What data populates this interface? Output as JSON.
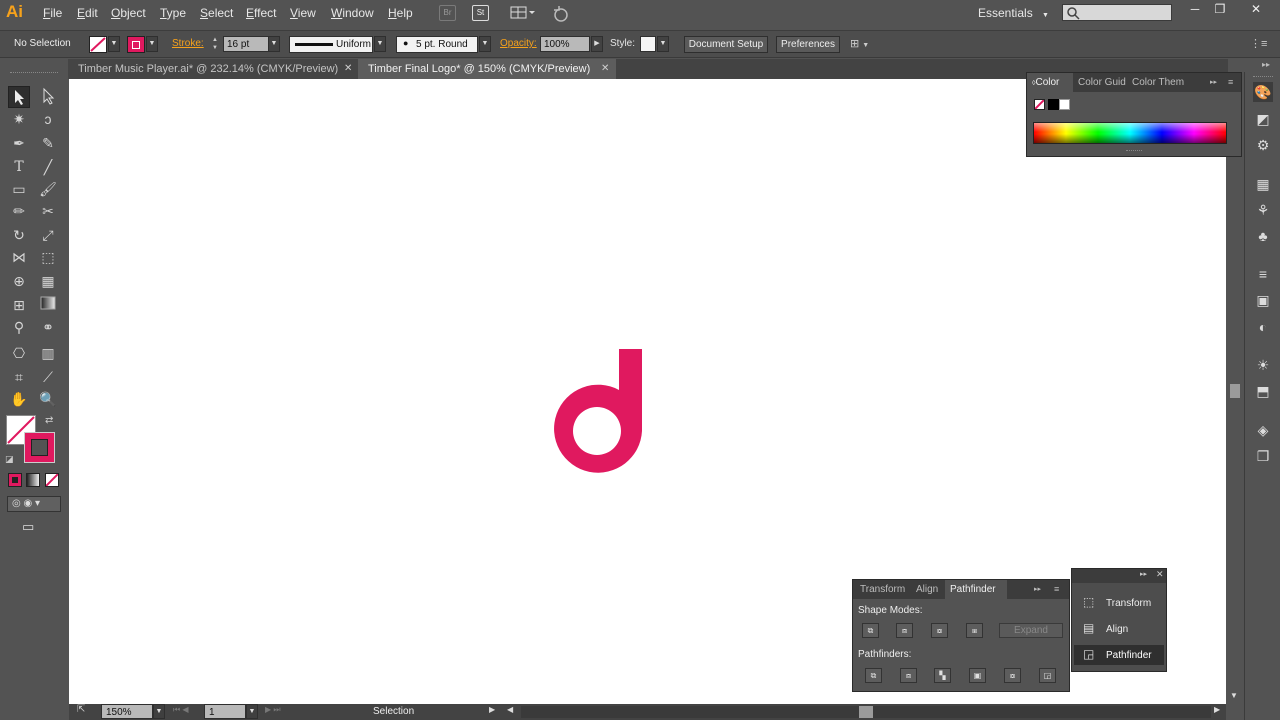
{
  "app": {
    "logo": "Ai"
  },
  "menu": [
    "File",
    "Edit",
    "Object",
    "Type",
    "Select",
    "Effect",
    "View",
    "Window",
    "Help"
  ],
  "menu_buttons": {
    "bridge": "Br",
    "stock": "St"
  },
  "workspace": {
    "label": "Essentials"
  },
  "search": {
    "placeholder": ""
  },
  "window_controls": {
    "minimize": "─",
    "restore": "❐",
    "close": "✕"
  },
  "control_bar": {
    "selection": "No Selection",
    "stroke_label": "Stroke:",
    "stroke_weight": "16 pt",
    "stroke_profile": "Uniform",
    "brush": "5 pt. Round",
    "opacity_label": "Opacity:",
    "opacity_value": "100%",
    "style_label": "Style:",
    "document_setup": "Document Setup",
    "preferences": "Preferences"
  },
  "tabs": [
    {
      "label": "Timber Music Player.ai* @ 232.14% (CMYK/Preview)",
      "active": false
    },
    {
      "label": "Timber Final Logo* @ 150% (CMYK/Preview)",
      "active": true
    }
  ],
  "colors": {
    "accent": "#e0195f",
    "stroke_label": "#f7a21b",
    "ui_bg": "#535353",
    "canvas": "#ffffff"
  },
  "color_panel": {
    "tabs": [
      "Color",
      "Color Guid",
      "Color Them"
    ]
  },
  "pathfinder_panel": {
    "tabs": [
      "Transform",
      "Align",
      "Pathfinder"
    ],
    "shape_modes_label": "Shape Modes:",
    "expand_label": "Expand",
    "pathfinders_label": "Pathfinders:"
  },
  "collapsed_panel": {
    "items": [
      "Transform",
      "Align",
      "Pathfinder"
    ]
  },
  "status_bar": {
    "zoom": "150%",
    "artboard": "1",
    "tool": "Selection"
  }
}
